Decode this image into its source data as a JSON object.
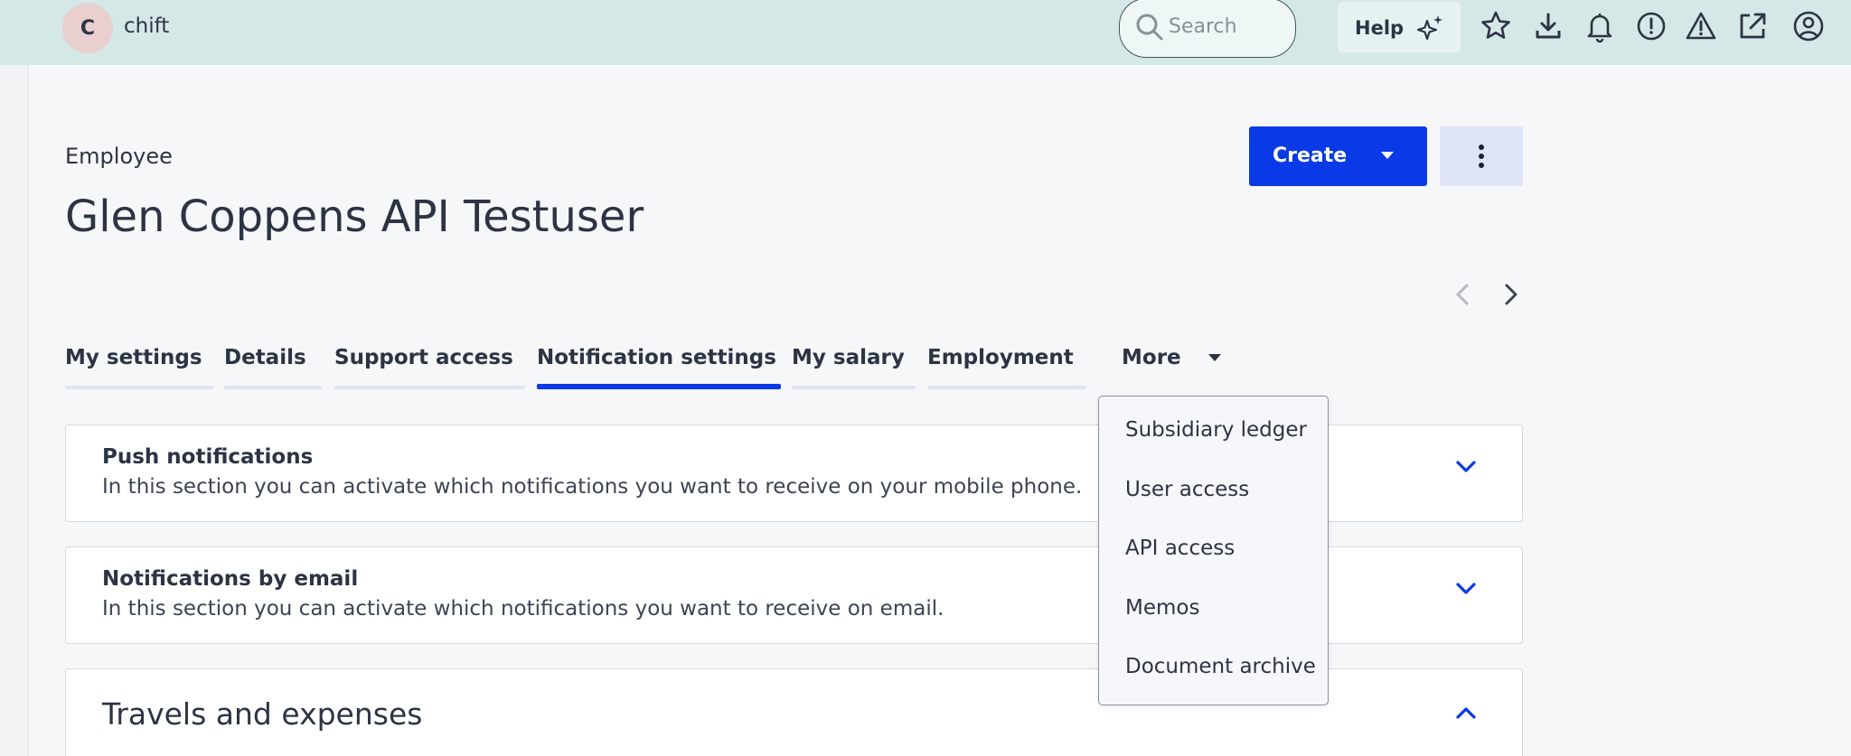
{
  "topbar": {
    "avatar_letter": "C",
    "company": "chift",
    "search_placeholder": "Search",
    "help_label": "Help",
    "icons": [
      "star-icon",
      "download-icon",
      "bell-icon",
      "alert-circle-icon",
      "warning-triangle-icon",
      "external-link-icon",
      "user-circle-icon"
    ]
  },
  "header": {
    "kind": "Employee",
    "title": "Glen Coppens API Testuser",
    "create_label": "Create"
  },
  "tabs": [
    {
      "label": "My settings",
      "active": false
    },
    {
      "label": "Details",
      "active": false
    },
    {
      "label": "Support access",
      "active": false
    },
    {
      "label": "Notification settings",
      "active": true
    },
    {
      "label": "My salary",
      "active": false
    },
    {
      "label": "Employment",
      "active": false
    },
    {
      "label": "More",
      "active": false
    }
  ],
  "more_menu": {
    "items": [
      "Subsidiary ledger",
      "User access",
      "API access",
      "Memos",
      "Document archive"
    ]
  },
  "sections": [
    {
      "heading": "Push notifications",
      "description": "In this section you can activate which notifications you want to receive on your mobile phone.",
      "expanded": false
    },
    {
      "heading": "Notifications by email",
      "description": "In this section you can activate which notifications you want to receive on email.",
      "expanded": false
    },
    {
      "heading": "Travels and expenses",
      "expanded": true
    }
  ],
  "colors": {
    "topbar_bg": "#d4e8e7",
    "primary": "#0a3ae8",
    "text": "#2c3444"
  }
}
